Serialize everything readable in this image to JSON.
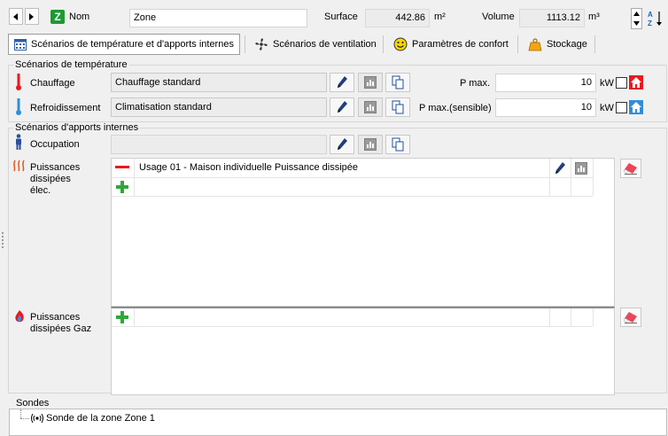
{
  "header": {
    "zone_icon_letter": "Z",
    "nom_label": "Nom",
    "nom_value": "Zone",
    "surface_label": "Surface",
    "surface_value": "442.86",
    "surface_unit": "m²",
    "volume_label": "Volume",
    "volume_value": "1113.12",
    "volume_unit": "m³"
  },
  "tabs": [
    {
      "label": "Scénarios de température et d'apports internes",
      "icon": "calendar-icon",
      "active": true
    },
    {
      "label": "Scénarios de ventilation",
      "icon": "fan-icon",
      "active": false
    },
    {
      "label": "Paramètres de confort",
      "icon": "smiley-icon",
      "active": false
    },
    {
      "label": "Stockage",
      "icon": "weight-icon",
      "active": false
    }
  ],
  "temperature": {
    "title": "Scénarios de température",
    "heating_label": "Chauffage",
    "heating_value": "Chauffage standard",
    "heating_pmax_label": "P max.",
    "heating_pmax_value": "10",
    "heating_pmax_unit": "kW",
    "cooling_label": "Refroidissement",
    "cooling_value": "Climatisation standard",
    "cooling_pmax_label": "P max.(sensible)",
    "cooling_pmax_value": "10",
    "cooling_pmax_unit": "kW"
  },
  "internal_gains": {
    "title": "Scénarios d'apports internes",
    "occupation_label": "Occupation",
    "occupation_value": "",
    "elec_label": "Puissances dissipées élec.",
    "elec_rows": [
      "Usage 01 - Maison individuelle  Puissance dissipée"
    ],
    "gas_label": "Puissances dissipées Gaz"
  },
  "sondes": {
    "title": "Sondes",
    "item": "Sonde de la zone Zone 1"
  },
  "colors": {
    "heating_red": "#e8191e",
    "cooling_blue": "#2f8fd8",
    "add_green": "#2ea83a",
    "zone_green": "#1e9a33"
  }
}
